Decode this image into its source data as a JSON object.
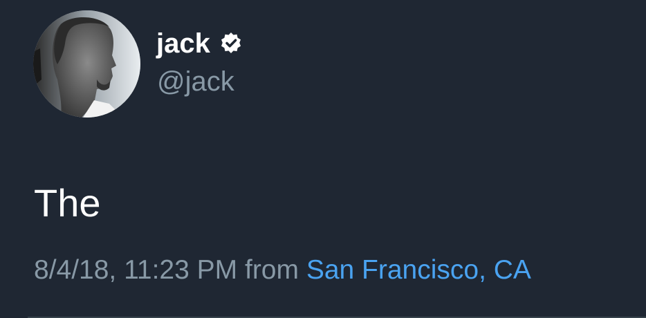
{
  "tweet": {
    "display_name": "jack",
    "handle": "@jack",
    "verified": true,
    "text": "The",
    "timestamp": "8/4/18, 11:23 PM",
    "from_label": "from",
    "location": "San Francisco, CA"
  },
  "colors": {
    "background": "#1f2733",
    "name": "#ffffff",
    "secondary_text": "#8899a6",
    "link": "#4aa3f1",
    "divider": "#38444d"
  },
  "icons": {
    "verified": "verified-badge-icon",
    "avatar": "profile-photo"
  }
}
